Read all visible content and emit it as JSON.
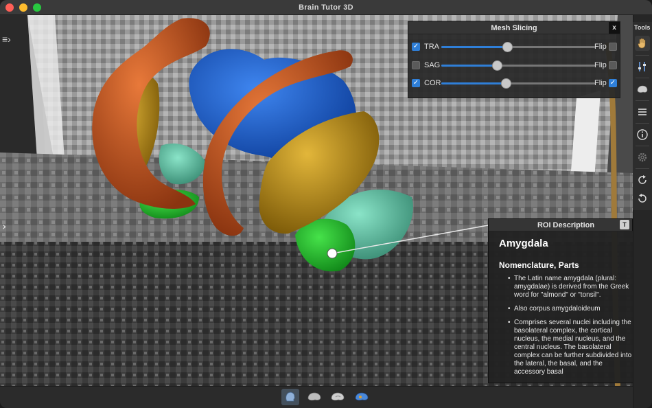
{
  "window": {
    "title": "Brain Tutor 3D"
  },
  "mesh_slicing": {
    "title": "Mesh Slicing",
    "close_label": "x",
    "flip_label": "Flip",
    "rows": [
      {
        "label": "TRA",
        "enabled": true,
        "value": 0.43,
        "flip": false
      },
      {
        "label": "SAG",
        "enabled": false,
        "value": 0.36,
        "flip": false
      },
      {
        "label": "COR",
        "enabled": true,
        "value": 0.42,
        "flip": true
      }
    ]
  },
  "roi": {
    "title": "ROI Description",
    "t_label": "T",
    "close_label": "x",
    "structure": "Amygdala",
    "section": "Nomenclature, Parts",
    "items": [
      "The Latin name amygdala (plural: amygdalae) is derived from the Greek word for \"almond\" or \"tonsil\".",
      "Also corpus amygdaloideum",
      "Comprises several nuclei including the basolateral complex, the cortical nucleus, the medial nucleus, and the central nucleus. The basolateral complex can be further subdivided into the lateral, the basal, and the accessory basal"
    ]
  },
  "tools": {
    "label": "Tools",
    "items": [
      "hand-icon",
      "sliders-icon",
      "brain-icon",
      "list-icon",
      "info-icon",
      "gear-icon",
      "rotate-cw-icon",
      "rotate-ccw-icon"
    ]
  },
  "bottom_views": [
    "head-view-icon",
    "brain-lateral-icon",
    "brain-medial-icon",
    "brain-colored-icon"
  ],
  "colors": {
    "accent": "#2f7fd8",
    "caudate": "#c8561e",
    "putamen": "#c49a1d",
    "thalamus": "#1a62d8",
    "amygdala": "#22c82e",
    "hippocampus": "#5ec8a6"
  }
}
